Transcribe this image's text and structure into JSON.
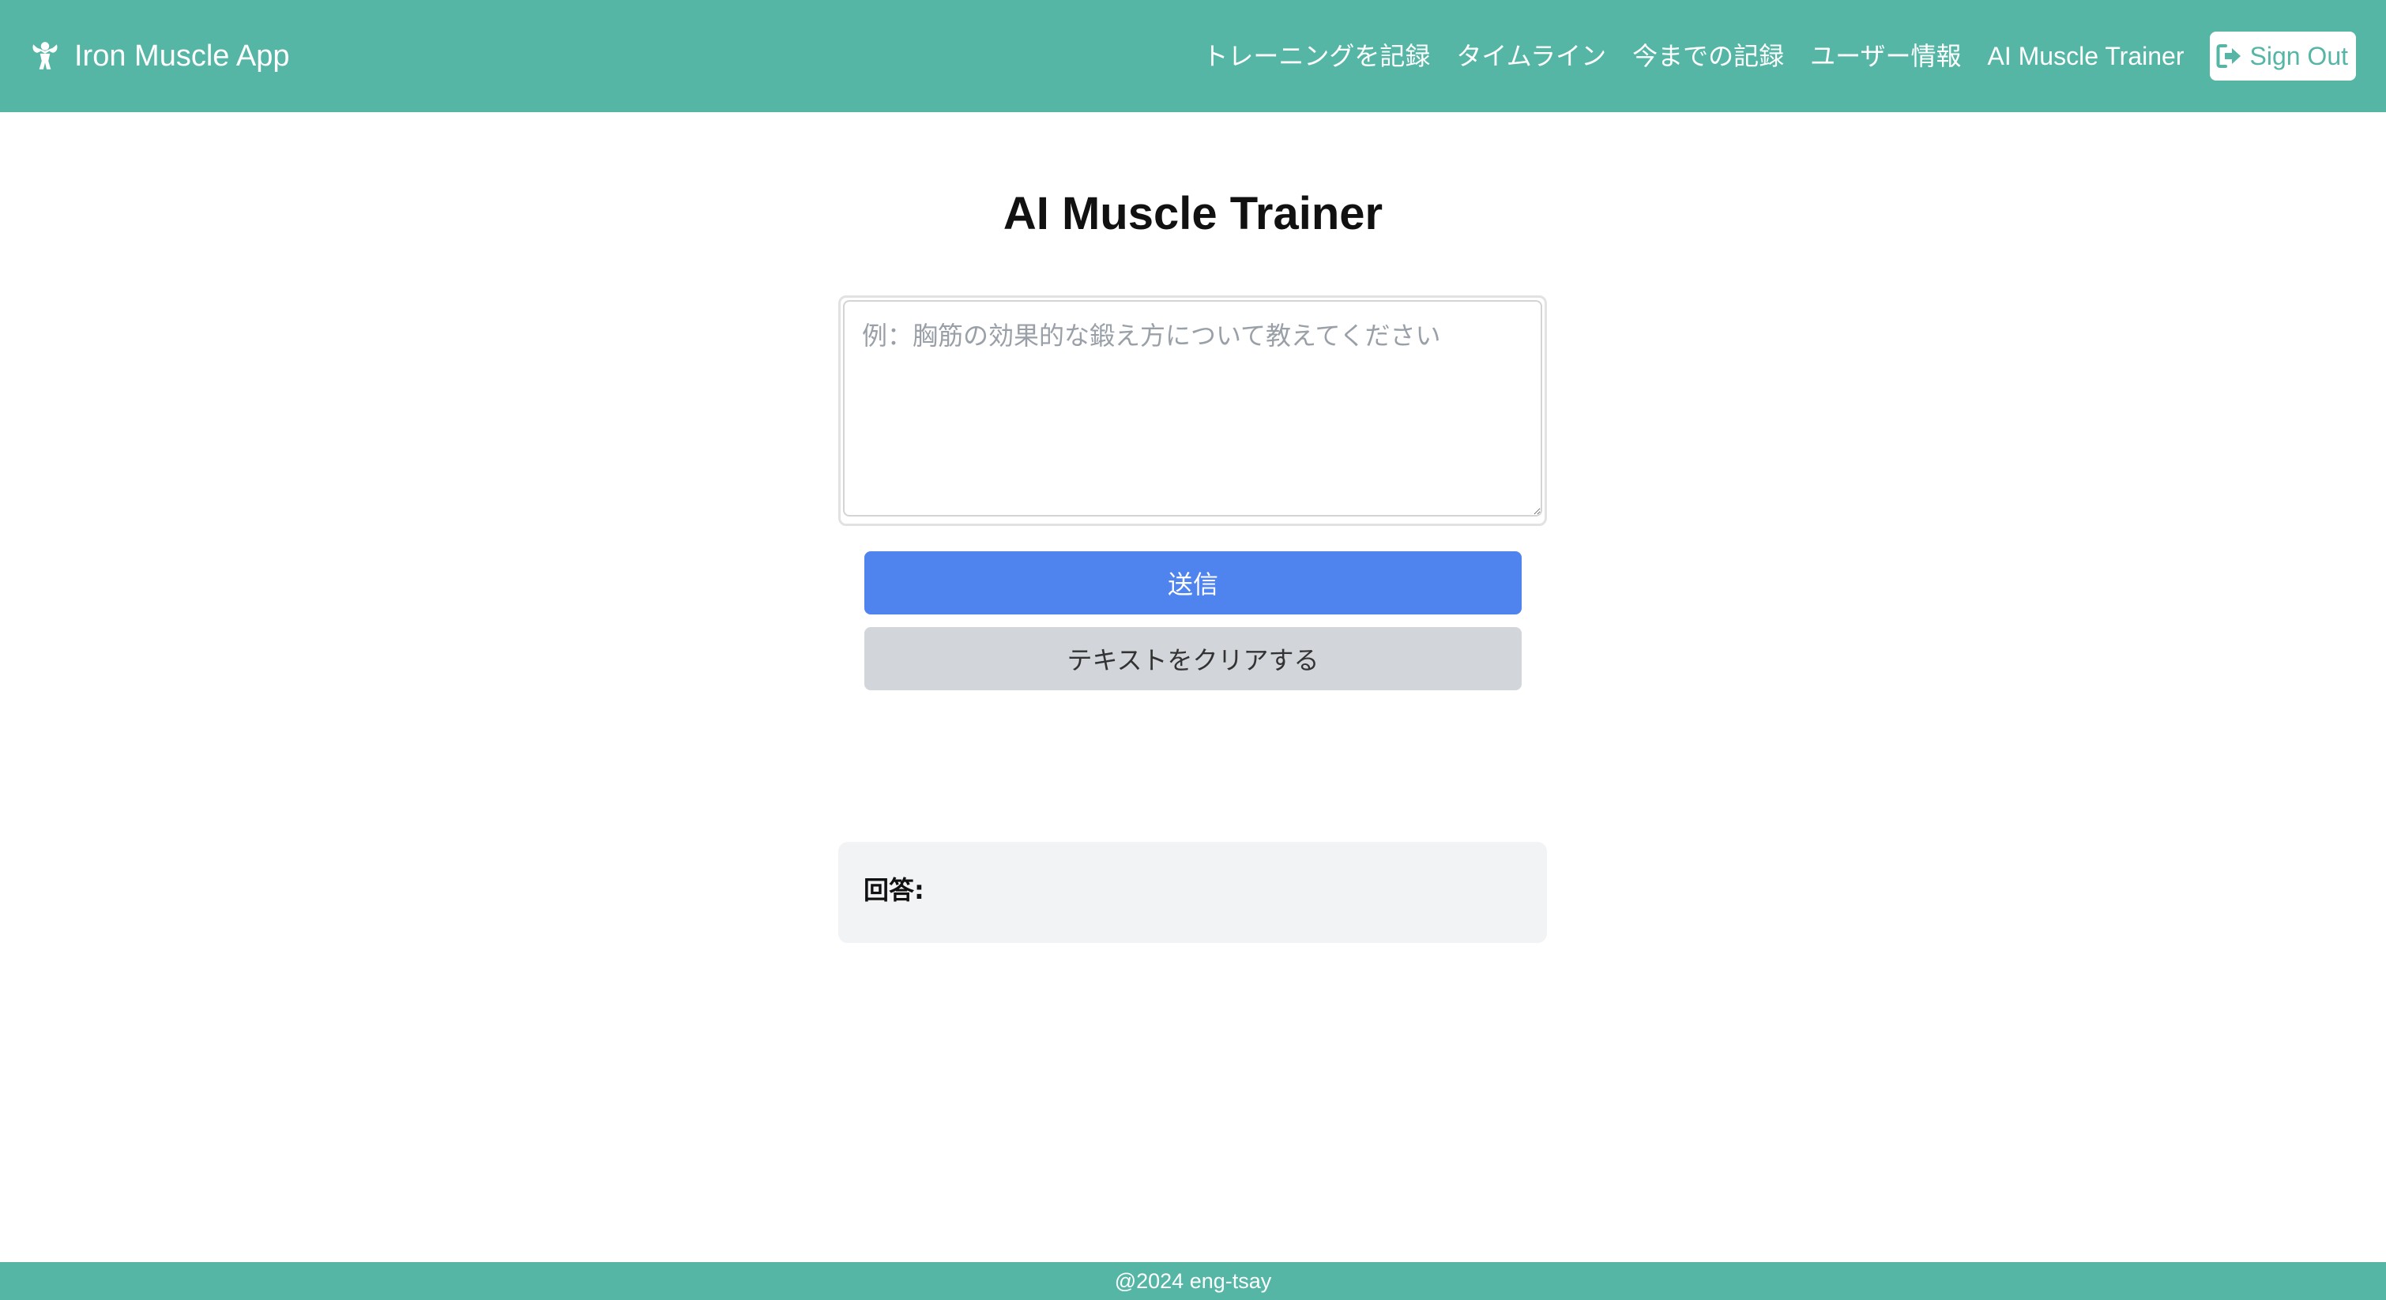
{
  "colors": {
    "header_bg": "#55b6a6",
    "submit_bg": "#4f83ee",
    "clear_bg": "#d2d5da",
    "answer_bg": "#f2f3f5"
  },
  "header": {
    "brand_icon": "bodybuilder-icon",
    "brand_name": "Iron Muscle App",
    "nav": [
      {
        "label": "トレーニングを記録"
      },
      {
        "label": "タイムライン"
      },
      {
        "label": "今までの記録"
      },
      {
        "label": "ユーザー情報"
      },
      {
        "label": "AI Muscle Trainer"
      }
    ],
    "signout": {
      "icon": "sign-out-icon",
      "label": "Sign Out"
    }
  },
  "main": {
    "title": "AI Muscle Trainer",
    "question": {
      "value": "",
      "placeholder": "例：胸筋の効果的な鍛え方について教えてください"
    },
    "submit_label": "送信",
    "clear_label": "テキストをクリアする",
    "answer": {
      "label": "回答:",
      "text": ""
    }
  },
  "footer": {
    "text": "@2024 eng-tsay"
  }
}
